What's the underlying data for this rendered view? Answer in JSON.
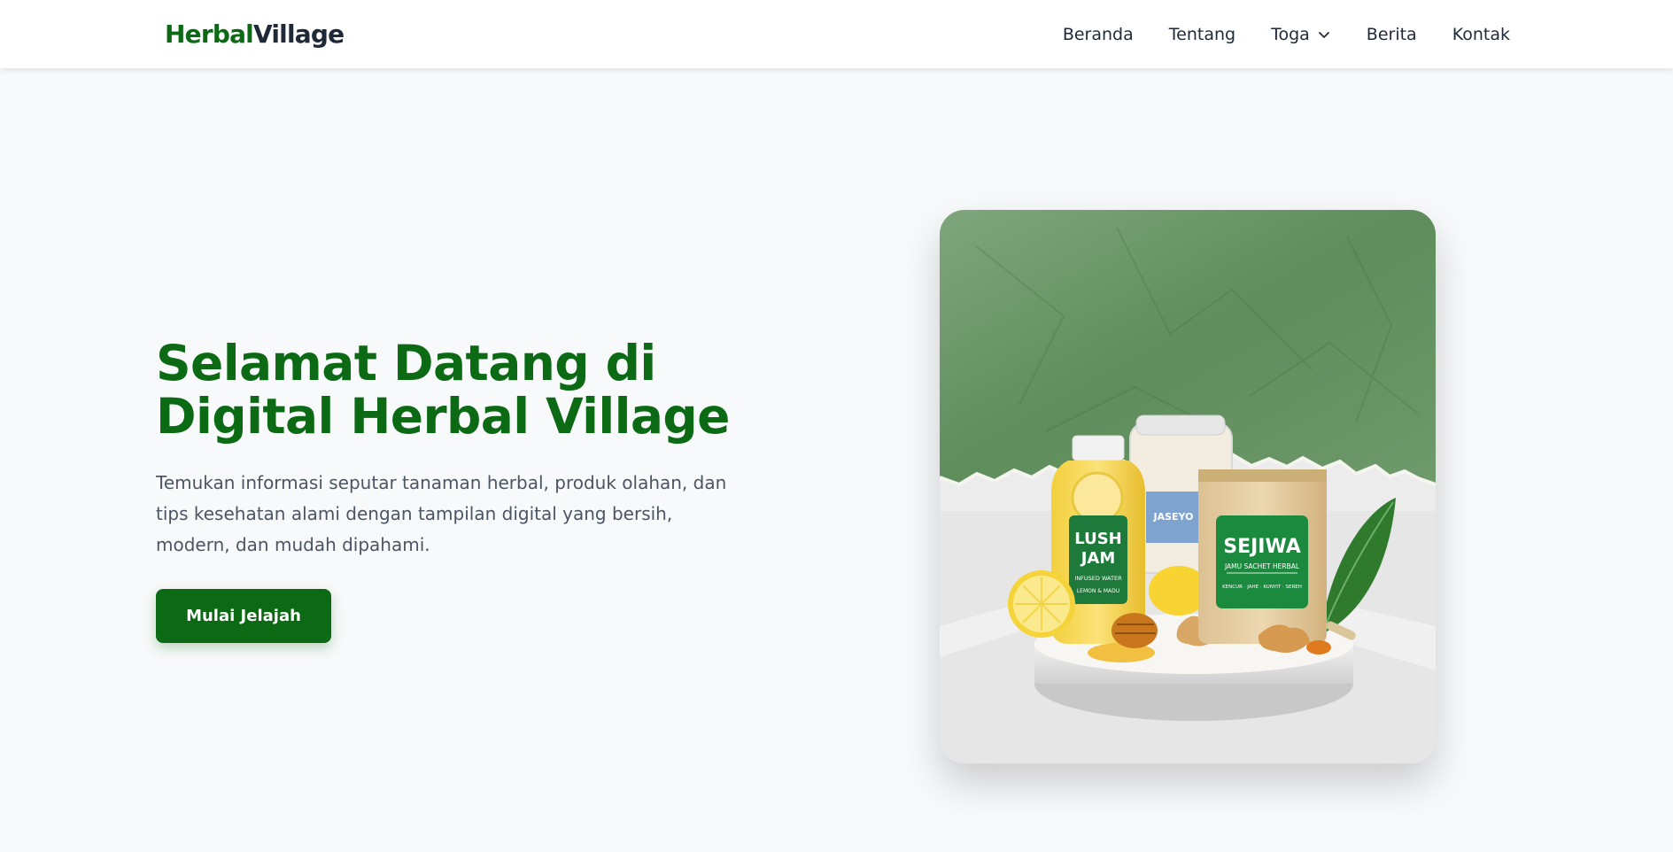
{
  "brand": {
    "part1": "Herbal",
    "part2": "Village"
  },
  "nav": {
    "items": [
      {
        "label": "Beranda"
      },
      {
        "label": "Tentang"
      },
      {
        "label": "Toga",
        "has_dropdown": true,
        "icon": "chevron-down-icon"
      },
      {
        "label": "Berita"
      },
      {
        "label": "Kontak"
      }
    ]
  },
  "hero": {
    "title_line1": "Selamat Datang di",
    "title_line2": "Digital Herbal Village",
    "subtitle_line1": "Temukan informasi seputar tanaman herbal, produk olahan, dan",
    "subtitle_line2": "tips kesehatan alami dengan tampilan digital yang bersih,",
    "subtitle_line3": "modern, dan mudah dipahami.",
    "cta_label": "Mulai Jelajah"
  },
  "product_image": {
    "bottle": {
      "name_line1": "LUSH",
      "name_line2": "JAM",
      "tagline": "INFUSED WATER",
      "flavor": "LEMON & MADU"
    },
    "jar_label": "JASEYO",
    "sachet": {
      "name": "SEJIWA",
      "tagline": "JAMU SACHET HERBAL",
      "ingredients": "KENCUR · JAHE · KUNYIT · SEREH"
    }
  },
  "colors": {
    "primary_green": "#0c6a14",
    "text_dark": "#1f2937",
    "text_muted": "#4b5563",
    "page_bg": "#f8f9fa"
  }
}
